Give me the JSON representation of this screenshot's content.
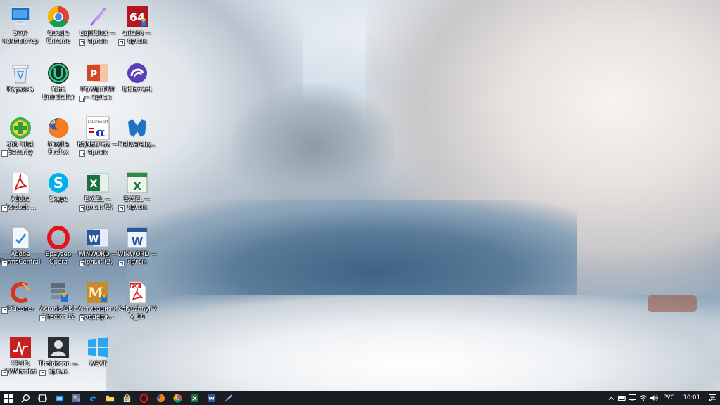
{
  "desktop": {
    "icons": [
      {
        "label": "Этот компьютер"
      },
      {
        "label": "Google Chrome"
      },
      {
        "label": "LightShot — ярлык"
      },
      {
        "label": "aida64 — ярлык"
      },
      {
        "label": "Корзина"
      },
      {
        "label": "IObit Uninstaller"
      },
      {
        "label": "POWERPNT — ярлык"
      },
      {
        "label": "BitTorrent"
      },
      {
        "label": "360 Total Security"
      },
      {
        "label": "Mozilla Firefox"
      },
      {
        "label": "EQNEDT32 — ярлык"
      },
      {
        "label": "Malwareby..."
      },
      {
        "label": "Adobe Acrobat ..."
      },
      {
        "label": "Skype"
      },
      {
        "label": "EXCEL — ярлык (2)"
      },
      {
        "label": "EXCEL — ярлык"
      },
      {
        "label": "Adobe FormsCentral"
      },
      {
        "label": "Браузер Opera"
      },
      {
        "label": "WINWORD — ярлык (2)"
      },
      {
        "label": "WINWORD — ярлык"
      },
      {
        "label": "CCleaner"
      },
      {
        "label": "Acronis Disk Director 12"
      },
      {
        "label": "Активация и поддерж..."
      },
      {
        "label": "Kalyuzhnyi V V_10"
      },
      {
        "label": "CPUID HWMonitor"
      },
      {
        "label": "Thaiphoon — ярлык"
      },
      {
        "label": "WSAT"
      }
    ],
    "glyphs": {
      "aida": "64",
      "eqn": "α",
      "eqn_top": "Microsoft",
      "excel": "X",
      "word": "W",
      "pdf": "PDF",
      "ppt": "P"
    }
  },
  "taskbar": {
    "language": "РУС",
    "time": "10:01"
  },
  "colors": {
    "taskbar": "#1a1d22",
    "accent": "#0078d7"
  }
}
